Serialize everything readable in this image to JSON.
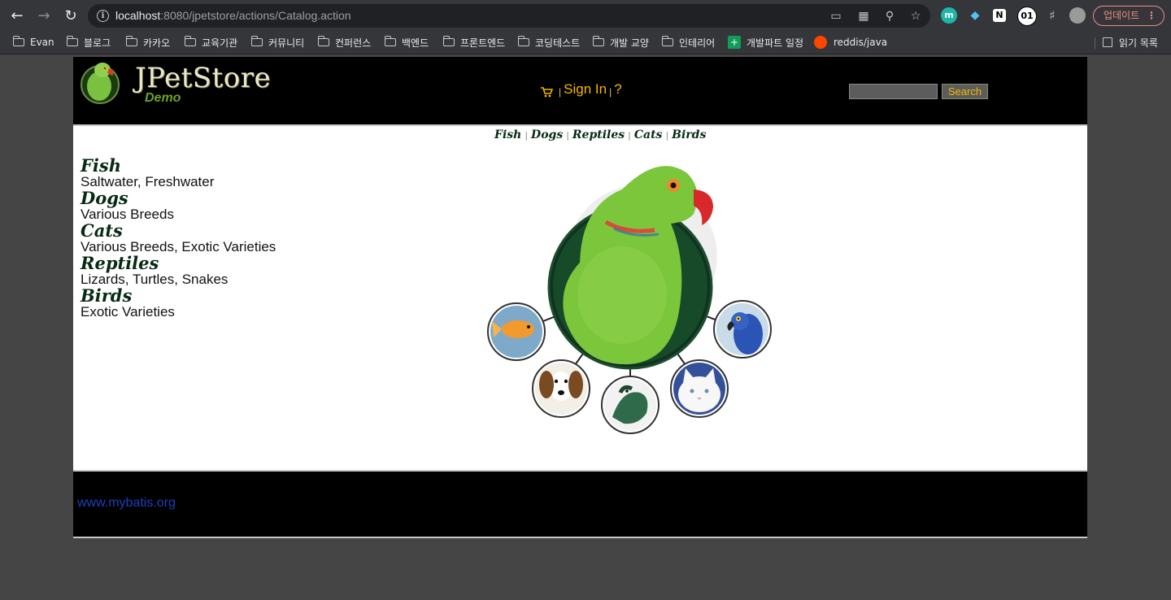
{
  "browser": {
    "url_host": "localhost",
    "url_rest": ":8080/jpetstore/actions/Catalog.action",
    "update_label": "업데이트",
    "ext_badge": "01",
    "ext_m": "m",
    "bookmarks": [
      "Evan",
      "블로그",
      "카카오",
      "교육기관",
      "커뮤니티",
      "컨퍼런스",
      "백엔드",
      "프론트엔드",
      "코딩테스트",
      "개발 교양",
      "인테리어",
      "개발파트 일정",
      "reddis/java"
    ],
    "reading_list": "읽기 목록"
  },
  "header": {
    "logo_title": "JPetStore",
    "logo_subtitle": "Demo",
    "sign_in": "Sign In",
    "help": "?",
    "search_value": "",
    "search_button": "Search"
  },
  "quicklinks": [
    "Fish",
    "Dogs",
    "Reptiles",
    "Cats",
    "Birds"
  ],
  "categories": [
    {
      "name": "Fish",
      "desc": "Saltwater, Freshwater"
    },
    {
      "name": "Dogs",
      "desc": "Various Breeds"
    },
    {
      "name": "Cats",
      "desc": "Various Breeds, Exotic Varieties"
    },
    {
      "name": "Reptiles",
      "desc": "Lizards, Turtles, Snakes"
    },
    {
      "name": "Birds",
      "desc": "Exotic Varieties"
    }
  ],
  "footer": {
    "link": "www.mybatis.org"
  },
  "colors": {
    "accent": "#f5b800",
    "header_bg": "#000000",
    "category_text": "#062a12",
    "footer_link": "#1d3fbf"
  }
}
